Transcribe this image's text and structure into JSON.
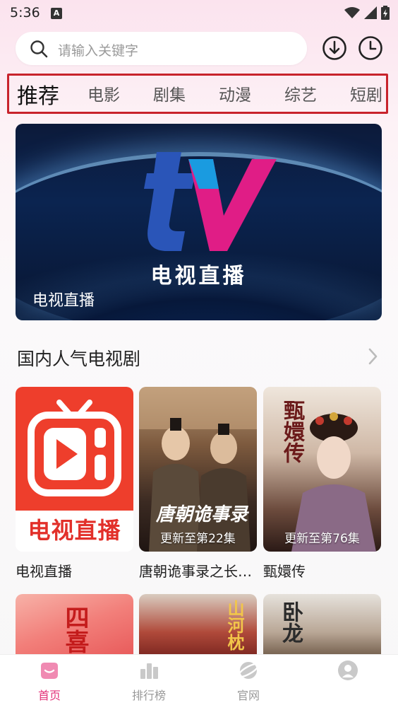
{
  "status_bar": {
    "time": "5:36",
    "notification_letter": "A"
  },
  "search": {
    "placeholder": "请输入关键字"
  },
  "header_icons": [
    "download-icon",
    "history-icon"
  ],
  "tabs": [
    {
      "label": "推荐",
      "active": true
    },
    {
      "label": "电影",
      "active": false
    },
    {
      "label": "剧集",
      "active": false
    },
    {
      "label": "动漫",
      "active": false
    },
    {
      "label": "综艺",
      "active": false
    },
    {
      "label": "短剧",
      "active": false
    }
  ],
  "banner": {
    "logo_text": "tv",
    "center_text": "电视直播",
    "caption": "电视直播"
  },
  "section": {
    "title": "国内人气电视剧"
  },
  "cards": [
    {
      "title": "电视直播",
      "overlay": "",
      "logo_caption": "电视直播"
    },
    {
      "title": "唐朝诡事录之长…",
      "overlay": "更新至第22集",
      "poster_text": "唐朝诡事录"
    },
    {
      "title": "甄嬛传",
      "overlay": "更新至第76集",
      "poster_text": "甄嬛传"
    }
  ],
  "cards_row2": [
    {
      "poster_text": "四喜"
    },
    {
      "poster_text": "山河枕"
    },
    {
      "poster_text": "卧龙"
    }
  ],
  "bottom_nav": [
    {
      "label": "首页",
      "icon": "home-icon",
      "active": true
    },
    {
      "label": "排行榜",
      "icon": "chart-icon",
      "active": false
    },
    {
      "label": "官网",
      "icon": "planet-icon",
      "active": false
    },
    {
      "label": "",
      "icon": "profile-icon",
      "active": false
    }
  ],
  "colors": {
    "accent": "#e3337a",
    "tab_frame": "#c8232c",
    "live_red": "#ee3e2c"
  }
}
